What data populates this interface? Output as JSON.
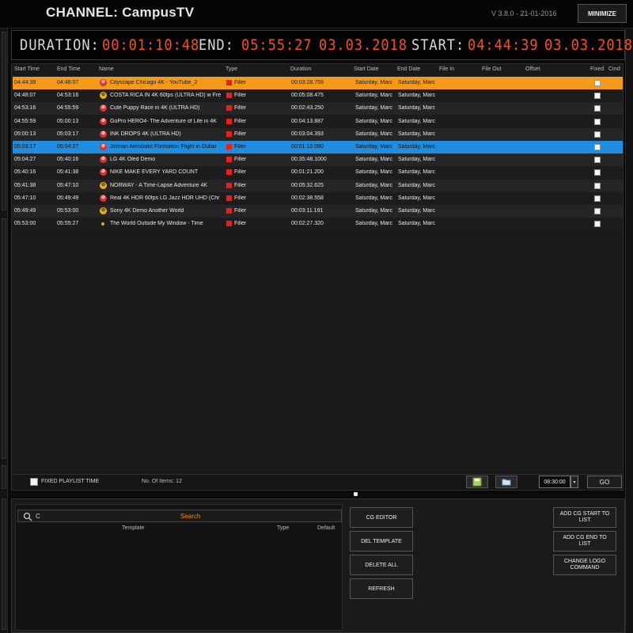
{
  "header": {
    "channel_title": "CHANNEL: CampusTV",
    "version": "V 3.8.0 - 21-01-2016",
    "minimize_label": "MINIMIZE"
  },
  "timer": {
    "duration_label": "DURATION:",
    "duration_value": "00:01:10:48",
    "end_label": "END:",
    "end_time": "05:55:27",
    "end_date": "03.03.2018",
    "start_label": "START:",
    "start_time": "04:44:39",
    "start_date": "03.03.2018"
  },
  "playlist": {
    "columns": [
      "Start Time",
      "End Time",
      "Name",
      "Type",
      "Duration",
      "Start Date",
      "End Date",
      "File In",
      "File Out",
      "Offset",
      "Fixed",
      "Cmd"
    ],
    "rows": [
      {
        "start": "04:44:39",
        "end": "04:48:07",
        "name": "Cityscape Chicago 4K - YouTube_2",
        "type": "Filler",
        "duration": "00:03:28.759",
        "start_date": "Saturday, Marc",
        "end_date": "Saturday, Marc",
        "status": "error",
        "state": "active"
      },
      {
        "start": "04:48:07",
        "end": "04:53:16",
        "name": "COSTA RICA IN 4K 60fps (ULTRA HD) w  Fre",
        "type": "Filler",
        "duration": "00:05:08.475",
        "start_date": "Saturday, Marc",
        "end_date": "Saturday, Marc",
        "status": "warn",
        "state": "normal"
      },
      {
        "start": "04:53:16",
        "end": "04:55:59",
        "name": "Cute Puppy Race in 4K (ULTRA HD)",
        "type": "Filler",
        "duration": "00:02:43.250",
        "start_date": "Saturday, Marc",
        "end_date": "Saturday, Marc",
        "status": "error",
        "state": "normal"
      },
      {
        "start": "04:55:59",
        "end": "05:00:13",
        "name": "GoPro HERO4- The Adventure of Life in 4K",
        "type": "Filler",
        "duration": "00:04:13.887",
        "start_date": "Saturday, Marc",
        "end_date": "Saturday, Marc",
        "status": "error",
        "state": "normal"
      },
      {
        "start": "05:00:13",
        "end": "05:03:17",
        "name": "INK DROPS 4K (ULTRA HD)",
        "type": "Filler",
        "duration": "00:03:04.393",
        "start_date": "Saturday, Marc",
        "end_date": "Saturday, Marc",
        "status": "error",
        "state": "normal"
      },
      {
        "start": "05:03:17",
        "end": "05:04:27",
        "name": "Jetman Aerobatic Formation Flight in Dubai",
        "type": "Filler",
        "duration": "00:01:10.080",
        "start_date": "Saturday, Marc",
        "end_date": "Saturday, Marc",
        "status": "error",
        "state": "selected"
      },
      {
        "start": "05:04:27",
        "end": "05:40:16",
        "name": "LG 4K Oled Demo",
        "type": "Filler",
        "duration": "00:35:48.1000",
        "start_date": "Saturday, Marc",
        "end_date": "Saturday, Marc",
        "status": "error",
        "state": "normal"
      },
      {
        "start": "05:40:16",
        "end": "05:41:38",
        "name": "NIKE  MAKE EVERY YARD COUNT",
        "type": "Filler",
        "duration": "00:01:21.200",
        "start_date": "Saturday, Marc",
        "end_date": "Saturday, Marc",
        "status": "error",
        "state": "normal"
      },
      {
        "start": "05:41:38",
        "end": "05:47:10",
        "name": "NORWAY - A Time-Lapse Adventure 4K",
        "type": "Filler",
        "duration": "00:05:32.625",
        "start_date": "Saturday, Marc",
        "end_date": "Saturday, Marc",
        "status": "warn",
        "state": "normal"
      },
      {
        "start": "05:47:10",
        "end": "05:49:49",
        "name": "Real 4K HDR 60fps  LG Jazz HDR UHD (Chr",
        "type": "Filler",
        "duration": "00:02:38.558",
        "start_date": "Saturday, Marc",
        "end_date": "Saturday, Marc",
        "status": "error",
        "state": "normal"
      },
      {
        "start": "05:49:49",
        "end": "05:53:00",
        "name": "Sony 4K Demo  Another World",
        "type": "Filler",
        "duration": "00:03:11.191",
        "start_date": "Saturday, Marc",
        "end_date": "Saturday, Marc",
        "status": "warn",
        "state": "normal"
      },
      {
        "start": "05:53:00",
        "end": "05:55:27",
        "name": "The World Outside My Window - Time",
        "type": "Filler",
        "duration": "00:02:27.320",
        "start_date": "Saturday, Marc",
        "end_date": "Saturday, Marc",
        "status": "dot",
        "state": "normal"
      }
    ],
    "footer": {
      "fixed_time_label": "FIXED PLAYLIST TIME",
      "items_count": "No. Of Items: 12",
      "time_value": "08:30:00",
      "go_label": "GO"
    }
  },
  "templates": {
    "search_value": "C",
    "search_button": "Search",
    "col_template": "Template",
    "col_type": "Type",
    "col_default": "Default"
  },
  "actions": {
    "cg_editor": "CG EDITOR",
    "del_template": "DEL TEMPLATE",
    "delete_all": "DELETE ALL",
    "refresh": "REFRESH",
    "add_cg_start": "ADD CG START TO LIST",
    "add_cg_end": "ADD CG END TO LIST",
    "change_logo": "CHANGE LOGO COMMAND"
  },
  "colors": {
    "active_row": "#f39a1b",
    "selected_row": "#1f8de0",
    "timer_digits": "#f0502a",
    "type_swatch": "#e0241b"
  }
}
